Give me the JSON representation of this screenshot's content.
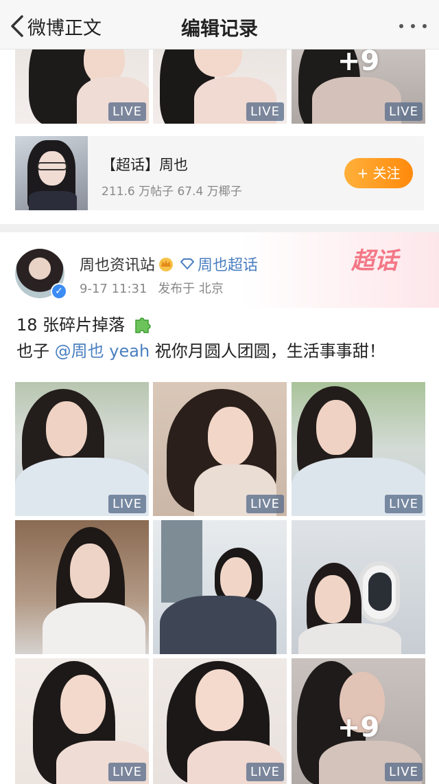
{
  "nav": {
    "back_label": "微博正文",
    "title": "编辑记录"
  },
  "top_grid": {
    "tiles": [
      {
        "badge": "LIVE"
      },
      {
        "badge": "LIVE"
      },
      {
        "badge": "LIVE",
        "more_count": "+9"
      }
    ]
  },
  "topic_card": {
    "name": "【超话】周也",
    "stats": "211.6 万帖子 67.4 万椰子",
    "follow_label": "+ 关注"
  },
  "post": {
    "header_mark": "超话",
    "author": "周也资讯站",
    "super_topic_link": "周也超话",
    "time": "9-17 11:31",
    "location": "发布于 北京",
    "text_line1": "18 张碎片掉落",
    "text_line2_prefix": "也子 ",
    "mention": "@周也 yeah",
    "text_line2_suffix": " 祝你月圆人团圆，生活事事甜！"
  },
  "grid": {
    "tiles": [
      {
        "badge": "LIVE"
      },
      {
        "badge": "LIVE"
      },
      {
        "badge": "LIVE"
      },
      {
        "badge": ""
      },
      {
        "badge": ""
      },
      {
        "badge": ""
      },
      {
        "badge": "LIVE"
      },
      {
        "badge": "LIVE"
      },
      {
        "badge": "LIVE",
        "more_count": "+9"
      }
    ]
  },
  "colors": {
    "accent_orange": "#ff9a1f",
    "link_blue": "#4a7fc0",
    "chaohua_pink": "#f37786"
  }
}
